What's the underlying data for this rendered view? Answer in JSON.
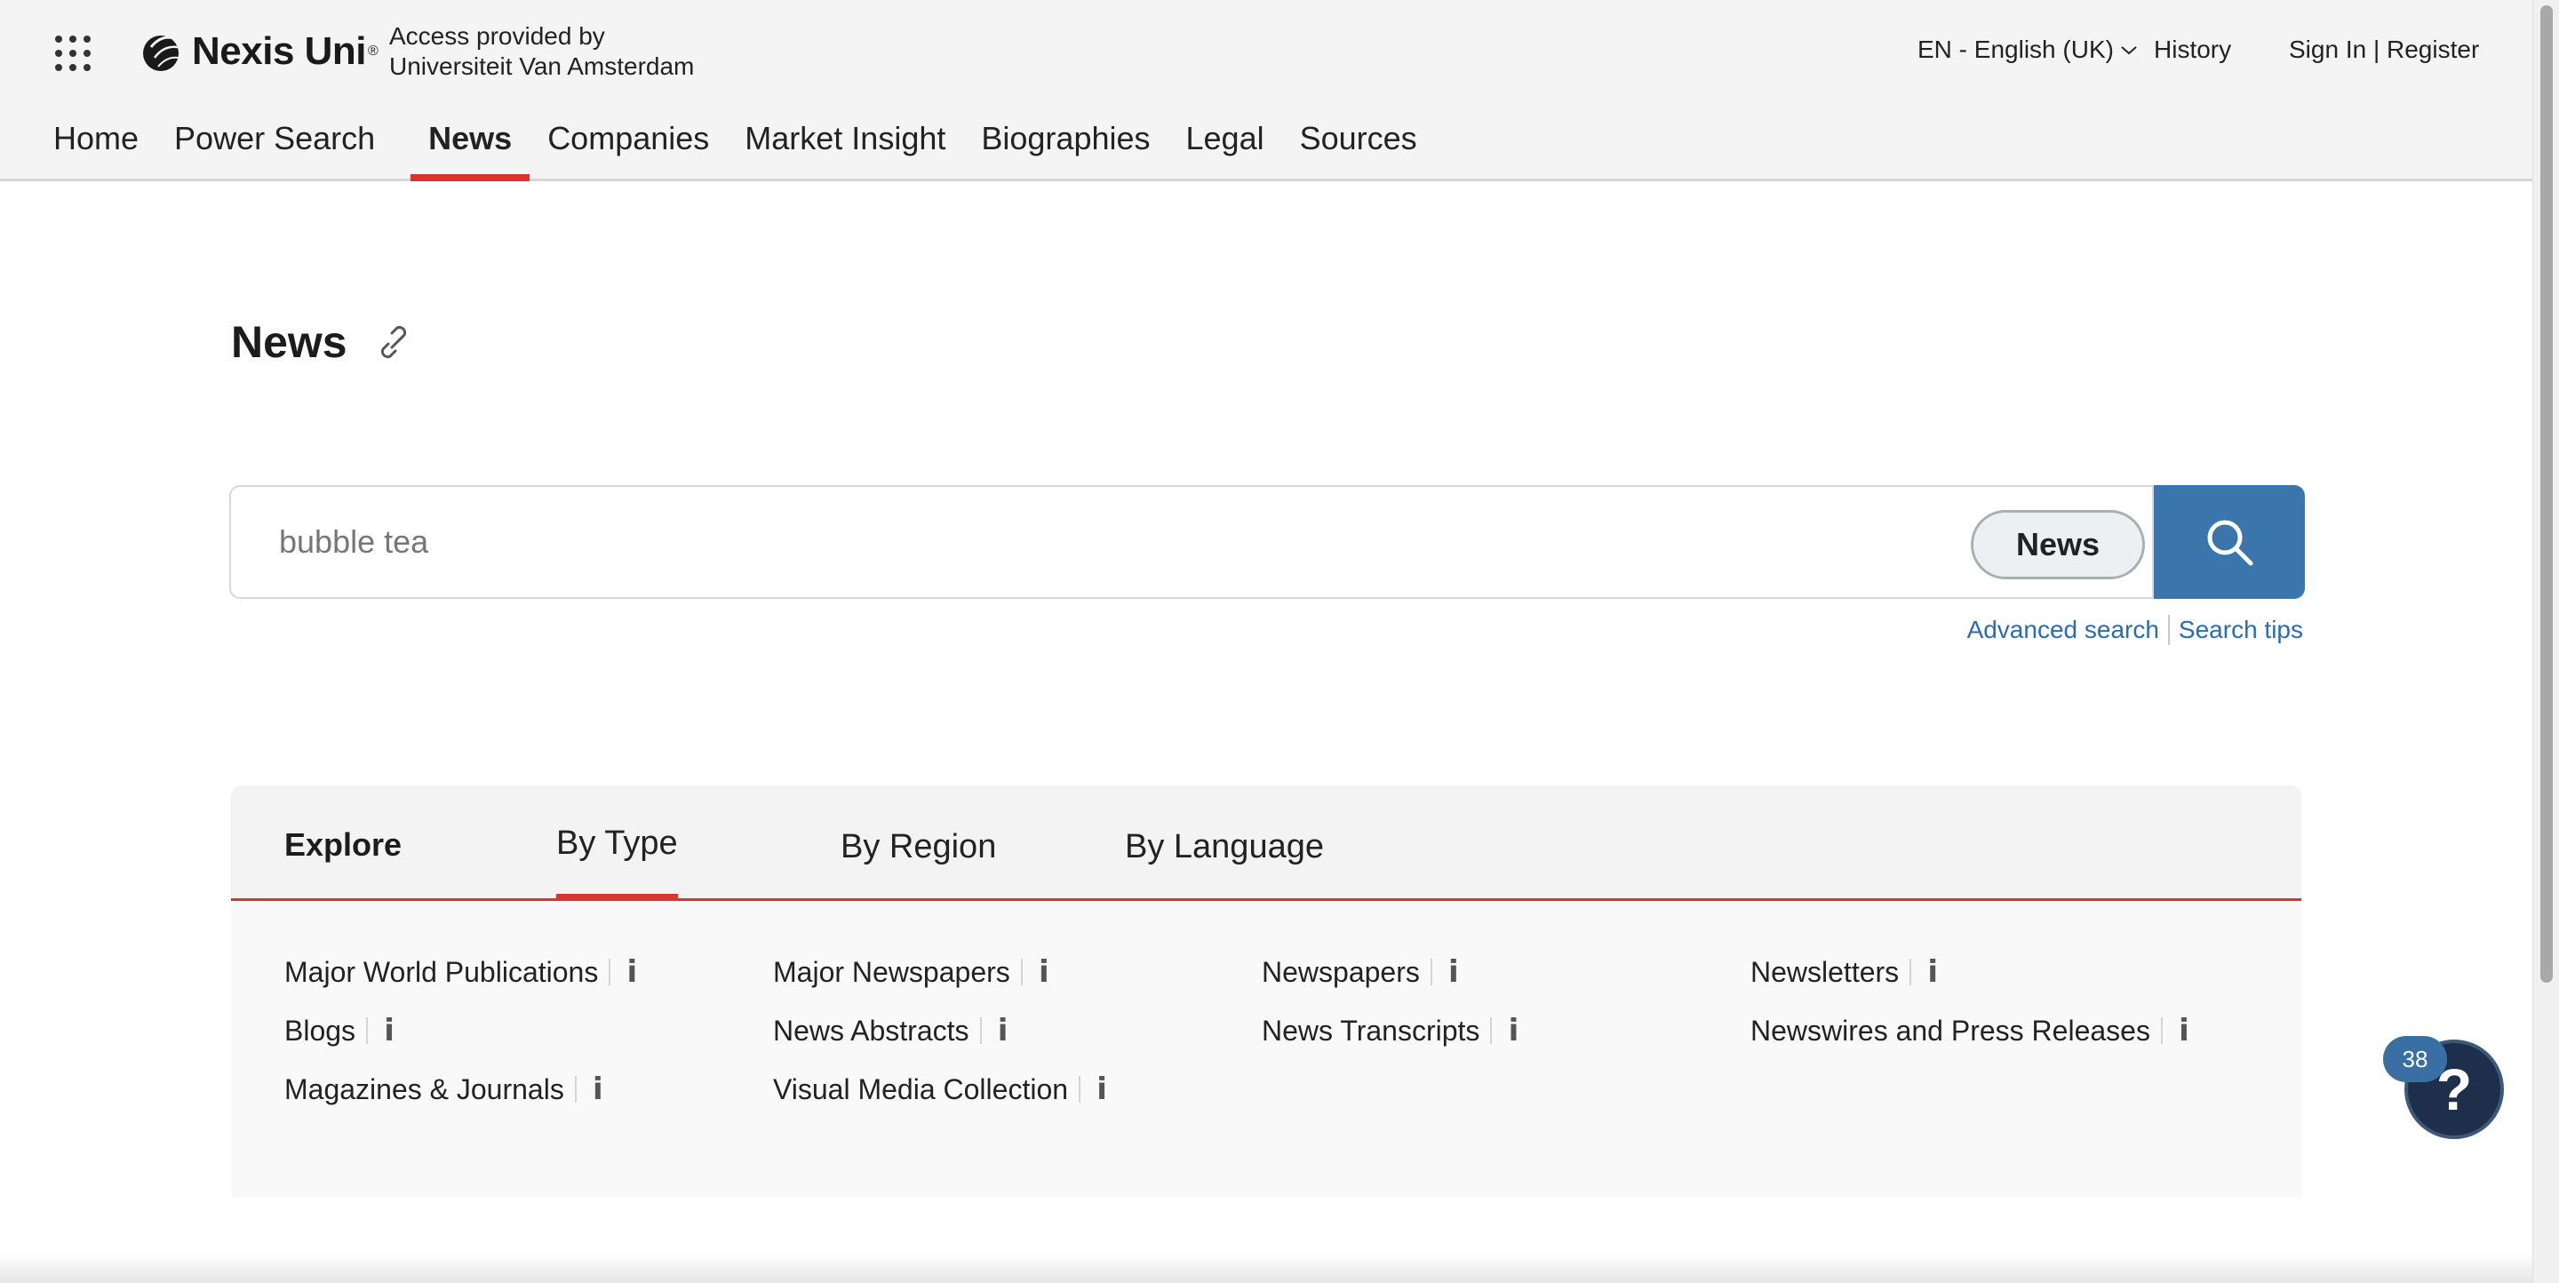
{
  "header": {
    "brand_name": "Nexis Uni",
    "brand_reg": "®",
    "access_line1": "Access provided by",
    "access_line2": "Universiteit Van Amsterdam",
    "language": "EN - English (UK)",
    "history": "History",
    "sign_in": "Sign In | Register"
  },
  "nav": {
    "items": [
      {
        "label": "Home"
      },
      {
        "label": "Power Search"
      },
      {
        "label": "News",
        "active": true
      },
      {
        "label": "Companies"
      },
      {
        "label": "Market Insight"
      },
      {
        "label": "Biographies"
      },
      {
        "label": "Legal"
      },
      {
        "label": "Sources"
      }
    ]
  },
  "main": {
    "title": "News",
    "search": {
      "value": "bubble tea",
      "scope": "News",
      "advanced_search": "Advanced search",
      "search_tips": "Search tips"
    },
    "explore": {
      "label": "Explore",
      "tabs": [
        {
          "label": "By Type",
          "active": true
        },
        {
          "label": "By Region"
        },
        {
          "label": "By Language"
        }
      ],
      "types": [
        {
          "label": "Major World Publications"
        },
        {
          "label": "Major Newspapers"
        },
        {
          "label": "Newspapers"
        },
        {
          "label": "Newsletters"
        },
        {
          "label": "Blogs"
        },
        {
          "label": "News Abstracts"
        },
        {
          "label": "News Transcripts"
        },
        {
          "label": "Newswires and Press Releases"
        },
        {
          "label": "Magazines & Journals"
        },
        {
          "label": "Visual Media Collection"
        }
      ],
      "info_glyph": "i"
    }
  },
  "help": {
    "glyph": "?",
    "badge": "38"
  },
  "colors": {
    "accent_red": "#d9352c",
    "search_blue": "#3a76ab",
    "link_blue": "#2b6cb0",
    "help_navy": "#1d2f4b"
  },
  "icons": [
    "apps-grid-icon",
    "nexis-logo-icon",
    "chevron-down-icon",
    "link-icon",
    "search-icon",
    "info-icon",
    "help-icon"
  ]
}
